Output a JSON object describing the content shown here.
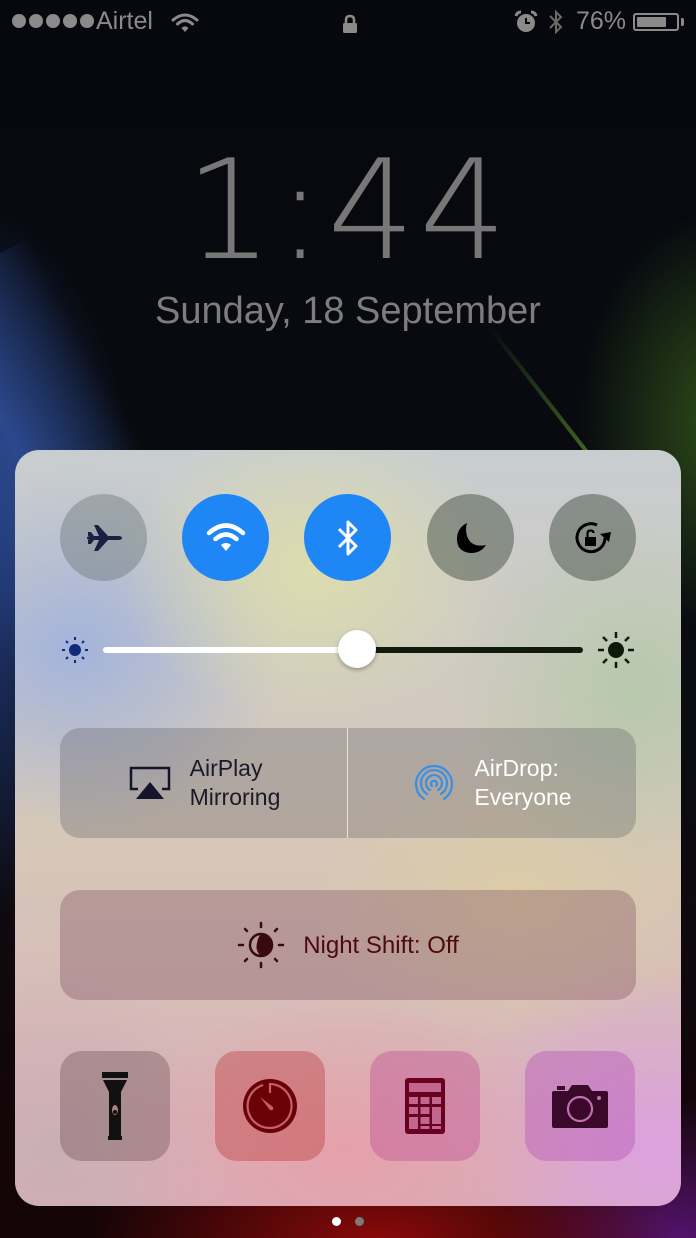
{
  "status_bar": {
    "signal_bars": 5,
    "carrier": "Airtel",
    "battery_percent_label": "76%",
    "battery_level": 0.76,
    "icons": [
      "signal-dots-icon",
      "wifi-icon",
      "lock-icon",
      "alarm-icon",
      "bluetooth-icon",
      "battery-icon"
    ]
  },
  "lock_screen": {
    "time": "1:44",
    "date": "Sunday, 18 September"
  },
  "control_center": {
    "toggles": [
      {
        "name": "airplane-mode",
        "icon": "airplane-icon",
        "state": "off"
      },
      {
        "name": "wifi",
        "icon": "wifi-icon",
        "state": "on"
      },
      {
        "name": "bluetooth",
        "icon": "bluetooth-icon",
        "state": "on"
      },
      {
        "name": "do-not-disturb",
        "icon": "moon-icon",
        "state": "off"
      },
      {
        "name": "rotation-lock",
        "icon": "rotation-lock-icon",
        "state": "off"
      }
    ],
    "brightness": {
      "value": 0.53,
      "min_icon": "sun-small-icon",
      "max_icon": "sun-large-icon"
    },
    "airplay": {
      "line1": "AirPlay",
      "line2": "Mirroring",
      "icon": "airplay-icon"
    },
    "airdrop": {
      "line1": "AirDrop:",
      "line2": "Everyone",
      "icon": "airdrop-icon"
    },
    "night_shift": {
      "label": "Night Shift: Off",
      "icon": "night-shift-icon"
    },
    "quick_apps": [
      {
        "name": "flashlight",
        "icon": "flashlight-icon"
      },
      {
        "name": "timer",
        "icon": "timer-icon"
      },
      {
        "name": "calculator",
        "icon": "calculator-icon"
      },
      {
        "name": "camera",
        "icon": "camera-icon"
      }
    ],
    "colors": {
      "toggle_on": "#1f86f5",
      "airdrop_icon": "#3b8fe0",
      "airplay_text": "#1c1a2a",
      "airdrop_text": "#ffffff",
      "night_shift_text": "#4a0a10"
    }
  },
  "page_indicator": {
    "pages": 2,
    "current": 1
  }
}
